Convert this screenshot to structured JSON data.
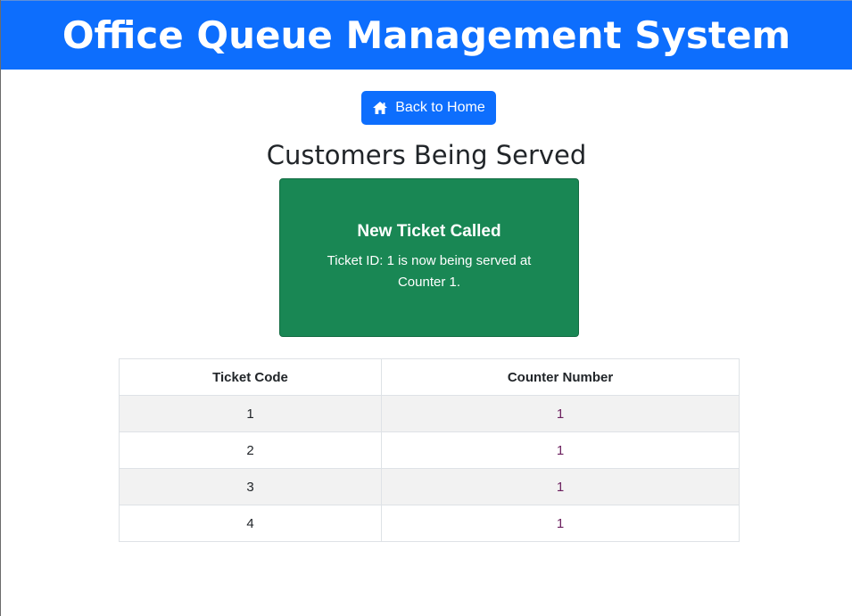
{
  "header": {
    "title": "Office Queue Management System"
  },
  "nav": {
    "home_button_label": "Back to Home",
    "home_icon": "home-icon"
  },
  "main": {
    "section_title": "Customers Being Served",
    "notification": {
      "title": "New Ticket Called",
      "message": "Ticket ID: 1 is now being served at Counter 1."
    },
    "table": {
      "columns": [
        "Ticket Code",
        "Counter Number"
      ],
      "rows": [
        {
          "ticket_code": "1",
          "counter_number": "1"
        },
        {
          "ticket_code": "2",
          "counter_number": "1"
        },
        {
          "ticket_code": "3",
          "counter_number": "1"
        },
        {
          "ticket_code": "4",
          "counter_number": "1"
        }
      ]
    }
  },
  "colors": {
    "primary": "#0d6efd",
    "success": "#198754"
  }
}
